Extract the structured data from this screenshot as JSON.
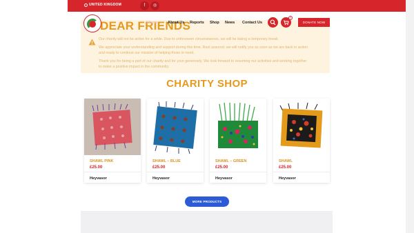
{
  "topbar": {
    "region": "UNITED KINGDOM",
    "social": [
      {
        "icon": "facebook-icon",
        "glyph": "f"
      },
      {
        "icon": "instagram-icon",
        "glyph": "◎"
      }
    ]
  },
  "nav": {
    "items": [
      "Home",
      "About Us",
      "Reports",
      "Shop",
      "News",
      "Contact Us"
    ],
    "cart_count": "0",
    "donate_label": "DONATE NOW"
  },
  "notice": {
    "title": "DEAR FRIENDS",
    "paragraphs": [
      "Our charity will not be active for a while. Due to unforeseen circumstances, we will be taking a temporary break.",
      "We appreciate your understanding and support during this time. Rest assured, we will notify you as soon as we are back in action and ready to continue our mission of helping those in need.",
      "Thank you for being a part of our charity and for your generosity. We look forward to resuming our activities and working together to make a positive impact in the community."
    ]
  },
  "shop": {
    "title": "CHARITY SHOP",
    "products": [
      {
        "name": "SHAWL PINK",
        "price": "£25.00",
        "vendor": "Heyvasor"
      },
      {
        "name": "SHAWL – BLUE",
        "price": "£25.00",
        "vendor": "Heyvasor"
      },
      {
        "name": "SHAWL – GREEN",
        "price": "£25.00",
        "vendor": "Heyvasor"
      },
      {
        "name": "SHAWL",
        "price": "£25.00",
        "vendor": "Heyvasor"
      }
    ],
    "more_label": "MORE PRODUCTS"
  },
  "colors": {
    "brand_red": "#d6262b",
    "accent_orange": "#e59a1f",
    "notice_bg": "#fdf3df",
    "button_blue": "#2b5bd6"
  }
}
